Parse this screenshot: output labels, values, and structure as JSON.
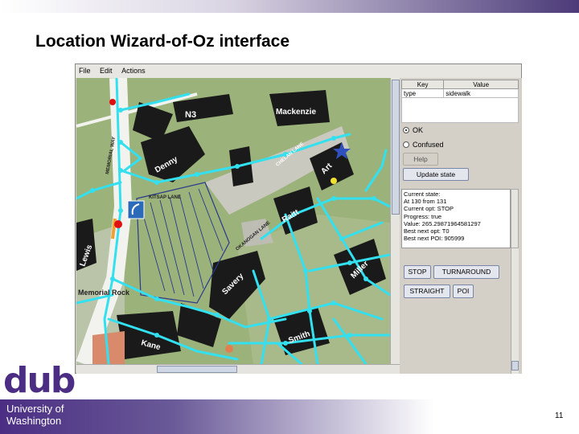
{
  "slide": {
    "title": "Location Wizard-of-Oz interface",
    "page_number": "11",
    "logo_text": "dub",
    "university_line1": "University of",
    "university_line2": "Washington"
  },
  "menu": [
    "File",
    "Edit",
    "Actions"
  ],
  "map_labels": {
    "n3": "N3",
    "mackenzie": "Mackenzie",
    "denny": "Denny",
    "memorial_way": "MEMORIAL WAY",
    "kitsap_lane": "KITSAP LANE",
    "chelan_lane": "CHELAN LANE",
    "okanogan_lane": "OKANOGAN LANE",
    "raitt": "Raitt",
    "savery": "Savery",
    "art": "Art",
    "kane": "Kane",
    "smith": "Smith",
    "miller": "Miller",
    "memorial_rock": "Memorial Rock",
    "lewis": "Lewis"
  },
  "table": {
    "headers": [
      "Key",
      "Value"
    ],
    "rows": [
      [
        "type",
        "sidewalk"
      ]
    ]
  },
  "radios": [
    {
      "label": "OK",
      "selected": true
    },
    {
      "label": "Confused",
      "selected": false
    }
  ],
  "buttons": {
    "help": "Help",
    "update_state": "Update state",
    "stop": "STOP",
    "turnaround": "TURNAROUND",
    "straight": "STRAIGHT",
    "poi": "POI"
  },
  "state": {
    "title": "Current state:",
    "lines": [
      "At 130 from 131",
      "Current opt: STOP",
      "Progress: true",
      "Value: 265.29871964581297",
      "Best next opt: T0",
      "Best next POI: 905999"
    ]
  },
  "colors": {
    "accent": "#4b2e83",
    "path": "#33e0f0",
    "map_green": "#9bb27a",
    "building": "#1a1a1a"
  }
}
